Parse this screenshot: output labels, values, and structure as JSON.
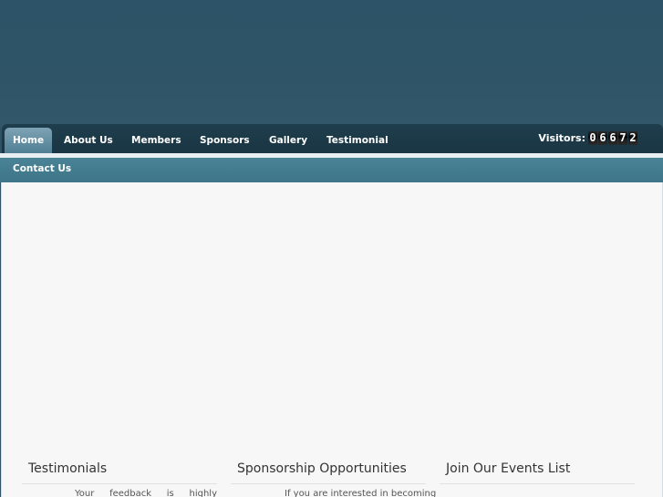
{
  "nav": {
    "items": [
      "Home",
      "About Us",
      "Members",
      "Sponsors",
      "Gallery",
      "Testimonial"
    ],
    "active": "Home",
    "second_row": "Contact Us"
  },
  "visitors": {
    "label": "Visitors:",
    "digits": [
      "0",
      "6",
      "6",
      "7",
      "2"
    ]
  },
  "columns": {
    "testimonials": {
      "title": "Testimonials",
      "text": "Your feedback is highly"
    },
    "sponsorship": {
      "title": "Sponsorship Opportunities",
      "text": "If you are interested in becoming"
    },
    "events": {
      "title": "Join Our Events List",
      "text": ""
    }
  },
  "colors": {
    "header_bg": "#2e5366",
    "navbar_bg": "#1f3e4d",
    "active_tab": "#6a95a8",
    "subbar_bg": "#457d90",
    "content_bg": "#f7f7f7"
  }
}
